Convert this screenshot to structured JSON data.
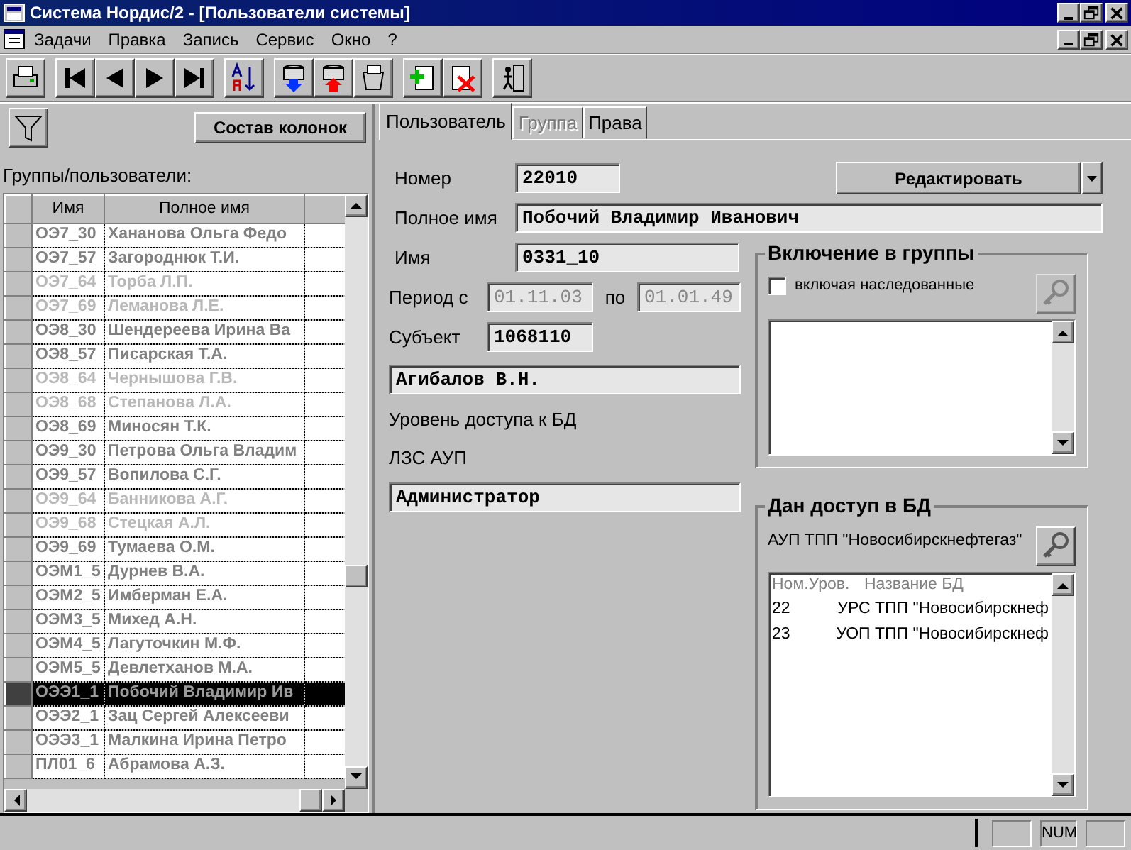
{
  "window": {
    "title": "Система Нордис/2 - [Пользователи системы]"
  },
  "menu": [
    {
      "label": "Задачи"
    },
    {
      "label": "Правка"
    },
    {
      "label": "Запись"
    },
    {
      "label": "Сервис"
    },
    {
      "label": "Окно"
    },
    {
      "label": "?"
    }
  ],
  "columns_button": "Состав колонок",
  "list_label": "Группы/пользователи:",
  "grid": {
    "columns": [
      "Имя",
      "Полное имя"
    ],
    "rows": [
      {
        "name": "ОЭ7_30",
        "full_name": "Хананова Ольга Федо",
        "inactive": false,
        "selected": false
      },
      {
        "name": "ОЭ7_57",
        "full_name": "Загороднюк Т.И.",
        "inactive": false,
        "selected": false
      },
      {
        "name": "ОЭ7_64",
        "full_name": "Торба Л.П.",
        "inactive": true,
        "selected": false
      },
      {
        "name": "ОЭ7_69",
        "full_name": "Леманова Л.Е.",
        "inactive": true,
        "selected": false
      },
      {
        "name": "ОЭ8_30",
        "full_name": "Шендереева Ирина Ва",
        "inactive": false,
        "selected": false
      },
      {
        "name": "ОЭ8_57",
        "full_name": "Писарская Т.А.",
        "inactive": false,
        "selected": false
      },
      {
        "name": "ОЭ8_64",
        "full_name": "Чернышова Г.В.",
        "inactive": true,
        "selected": false
      },
      {
        "name": "ОЭ8_68",
        "full_name": "Степанова Л.А.",
        "inactive": true,
        "selected": false
      },
      {
        "name": "ОЭ8_69",
        "full_name": "Миносян Т.К.",
        "inactive": false,
        "selected": false
      },
      {
        "name": "ОЭ9_30",
        "full_name": "Петрова Ольга Владим",
        "inactive": false,
        "selected": false
      },
      {
        "name": "ОЭ9_57",
        "full_name": "Вопилова С.Г.",
        "inactive": false,
        "selected": false
      },
      {
        "name": "ОЭ9_64",
        "full_name": "Банникова А.Г.",
        "inactive": true,
        "selected": false
      },
      {
        "name": "ОЭ9_68",
        "full_name": "Стецкая А.Л.",
        "inactive": true,
        "selected": false
      },
      {
        "name": "ОЭ9_69",
        "full_name": "Тумаева О.М.",
        "inactive": false,
        "selected": false
      },
      {
        "name": "ОЭМ1_5",
        "full_name": "Дурнев В.А.",
        "inactive": false,
        "selected": false
      },
      {
        "name": "ОЭМ2_5",
        "full_name": "Имберман Е.А.",
        "inactive": false,
        "selected": false
      },
      {
        "name": "ОЭМ3_5",
        "full_name": "Михед А.Н.",
        "inactive": false,
        "selected": false
      },
      {
        "name": "ОЭМ4_5",
        "full_name": "Лагуточкин М.Ф.",
        "inactive": false,
        "selected": false
      },
      {
        "name": "ОЭМ5_5",
        "full_name": "Девлетханов М.А.",
        "inactive": false,
        "selected": false
      },
      {
        "name": "ОЭЭ1_1",
        "full_name": "Побочий Владимир Ив",
        "inactive": false,
        "selected": true
      },
      {
        "name": "ОЭЭ2_1",
        "full_name": "Зац Сергей Алексееви",
        "inactive": false,
        "selected": false
      },
      {
        "name": "ОЭЭ3_1",
        "full_name": "Малкина Ирина Петро",
        "inactive": false,
        "selected": false
      },
      {
        "name": "ПЛ01_6",
        "full_name": "Абрамова А.З.",
        "inactive": false,
        "selected": false
      }
    ]
  },
  "tabs": [
    {
      "label": "Пользователь",
      "selected": true,
      "disabled": false
    },
    {
      "label": "Группа",
      "selected": false,
      "disabled": true
    },
    {
      "label": "Права",
      "selected": false,
      "disabled": false
    }
  ],
  "form": {
    "number_label": "Номер",
    "number": "22010",
    "edit_button": "Редактировать",
    "full_name_label": "Полное имя",
    "full_name": "Побочий Владимир Иванович",
    "name_label": "Имя",
    "name": "0331_10",
    "period_label": "Период с",
    "period_from": "01.11.03",
    "period_to_label": "по",
    "period_to": "01.01.49",
    "subject_label": "Субъект",
    "subject": "1068110",
    "subject_name": "Агибалов В.Н.",
    "access_label": "Уровень доступа к БД",
    "access_group": "ЛЗС АУП",
    "access_level": "Администратор"
  },
  "groups_box": {
    "title": "Включение в группы",
    "inherited_label": "включая наследованные",
    "inherited_checked": false
  },
  "db_box": {
    "title": "Дан доступ в БД",
    "org": "АУП ТПП \"Новосибирскнефтегаз\"",
    "columns": [
      "Ном.Уров.",
      "Название БД"
    ],
    "rows": [
      {
        "level": "22",
        "name": "УРС ТПП \"Новосибирскнеф"
      },
      {
        "level": "23",
        "name": "УОП ТПП \"Новосибирскнеф"
      }
    ]
  },
  "status_bar": {
    "indicator": "NUM"
  }
}
